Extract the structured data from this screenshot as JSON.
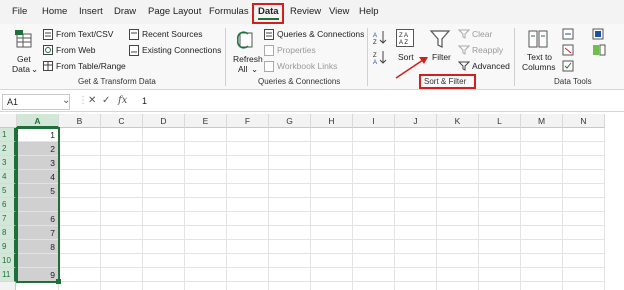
{
  "menu": {
    "tabs": [
      "File",
      "Home",
      "Insert",
      "Draw",
      "Page Layout",
      "Formulas",
      "Data",
      "Review",
      "View",
      "Help"
    ],
    "active": "Data"
  },
  "ribbon": {
    "get_transform": {
      "get_data_1": "Get",
      "get_data_2": "Data",
      "from_text_csv": "From Text/CSV",
      "from_web": "From Web",
      "from_table_range": "From Table/Range",
      "recent_sources": "Recent Sources",
      "existing_connections": "Existing Connections",
      "group_label": "Get & Transform Data"
    },
    "queries": {
      "refresh_1": "Refresh",
      "refresh_2": "All",
      "queries_connections": "Queries & Connections",
      "properties": "Properties",
      "workbook_links": "Workbook Links",
      "group_label": "Queries & Connections"
    },
    "sort_filter": {
      "sort": "Sort",
      "filter": "Filter",
      "clear": "Clear",
      "reapply": "Reapply",
      "advanced": "Advanced",
      "group_label": "Sort & Filter"
    },
    "data_tools": {
      "text_to_1": "Text to",
      "text_to_2": "Columns",
      "group_label": "Data Tools"
    }
  },
  "formula_bar": {
    "name_box": "A1",
    "fx": "fx",
    "value": "1"
  },
  "sheet": {
    "columns": [
      "A",
      "B",
      "C",
      "D",
      "E",
      "F",
      "G",
      "H",
      "I",
      "J",
      "K",
      "L",
      "M",
      "N"
    ],
    "rows": [
      "1",
      "2",
      "3",
      "4",
      "5",
      "6",
      "7",
      "8",
      "9",
      "10",
      "11"
    ],
    "col_a_values": [
      "1",
      "2",
      "3",
      "4",
      "5",
      "",
      "6",
      "7",
      "8",
      "",
      "9"
    ]
  },
  "colors": {
    "accent": "#1f6f3b",
    "highlight": "#d41f1f"
  }
}
